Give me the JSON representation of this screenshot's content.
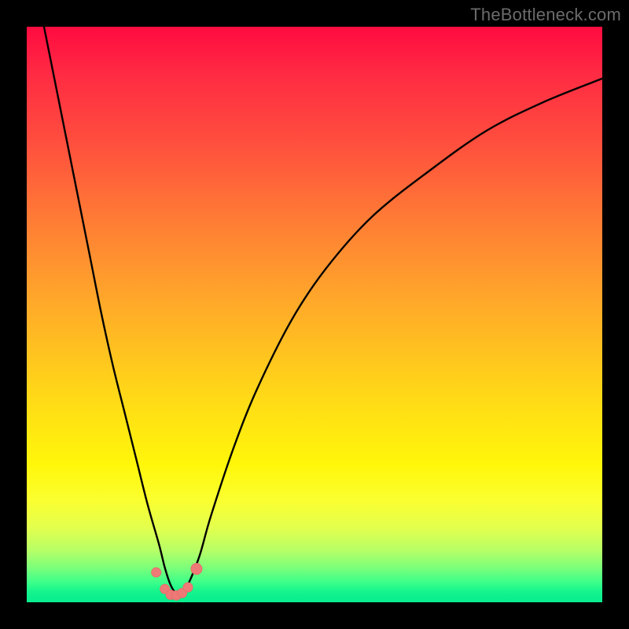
{
  "watermark": "TheBottleneck.com",
  "colors": {
    "frame": "#000000",
    "curve": "#000000",
    "marker_fill": "#ee7a77",
    "marker_stroke": "#e66e6b",
    "gradient_top": "#ff0b40",
    "gradient_bottom": "#0aee8f"
  },
  "chart_data": {
    "type": "line",
    "title": "",
    "xlabel": "",
    "ylabel": "",
    "xlim": [
      0,
      100
    ],
    "ylim": [
      0,
      100
    ],
    "annotations": [],
    "series": [
      {
        "name": "bottleneck-curve",
        "x": [
          3,
          5,
          7,
          9,
          11,
          13,
          15,
          17,
          19,
          21,
          23,
          24,
          25,
          26,
          27,
          28,
          30,
          32,
          36,
          40,
          46,
          52,
          60,
          70,
          80,
          90,
          100
        ],
        "y": [
          100,
          90,
          80,
          70,
          60,
          50,
          41,
          33,
          25,
          17,
          10,
          6,
          3,
          1.5,
          1.5,
          3,
          8,
          15,
          27,
          37,
          49,
          58,
          67,
          75,
          82,
          87,
          91
        ]
      }
    ],
    "markers": {
      "name": "highlight-points",
      "x": [
        22.5,
        24,
        25,
        26,
        27,
        28,
        29.5
      ],
      "y": [
        5.2,
        2.3,
        1.3,
        1.2,
        1.6,
        2.6,
        5.8
      ],
      "r": [
        6,
        6,
        6,
        6,
        6,
        6,
        7
      ]
    }
  }
}
